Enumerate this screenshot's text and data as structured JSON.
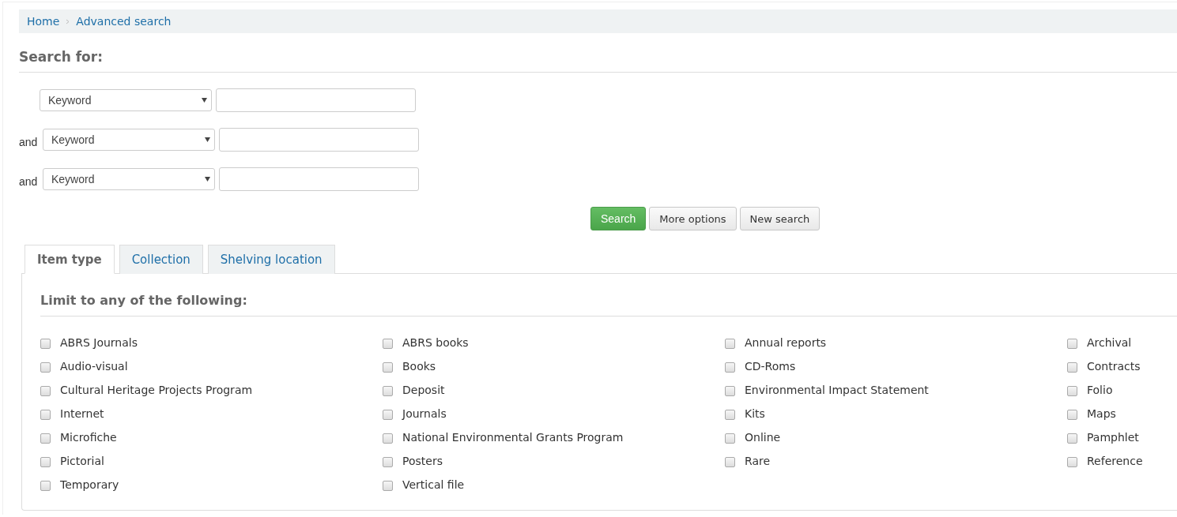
{
  "breadcrumb": [
    {
      "label": "Home"
    },
    {
      "label": "Advanced search"
    }
  ],
  "heading": "Search for:",
  "search_rows": [
    {
      "connector": "",
      "field": "Keyword",
      "value": ""
    },
    {
      "connector": "and",
      "field": "Keyword",
      "value": ""
    },
    {
      "connector": "and",
      "field": "Keyword",
      "value": ""
    }
  ],
  "buttons": [
    {
      "label": "Search",
      "kind": "primary"
    },
    {
      "label": "More options",
      "kind": "default"
    },
    {
      "label": "New search",
      "kind": "default"
    }
  ],
  "tabs": [
    {
      "label": "Item type",
      "selected": true
    },
    {
      "label": "Collection",
      "selected": false
    },
    {
      "label": "Shelving location",
      "selected": false
    }
  ],
  "limit_heading": "Limit to any of the following:",
  "item_types": [
    {
      "label": "ABRS Journals",
      "checked": false
    },
    {
      "label": "ABRS books",
      "checked": false
    },
    {
      "label": "Annual reports",
      "checked": false
    },
    {
      "label": "Archival",
      "checked": false
    },
    {
      "label": "Audio-visual",
      "checked": false
    },
    {
      "label": "Books",
      "checked": false
    },
    {
      "label": "CD-Roms",
      "checked": false
    },
    {
      "label": "Contracts",
      "checked": false
    },
    {
      "label": "Cultural Heritage Projects Program",
      "checked": false
    },
    {
      "label": "Deposit",
      "checked": false
    },
    {
      "label": "Environmental Impact Statement",
      "checked": false
    },
    {
      "label": "Folio",
      "checked": false
    },
    {
      "label": "Internet",
      "checked": false
    },
    {
      "label": "Journals",
      "checked": false
    },
    {
      "label": "Kits",
      "checked": false
    },
    {
      "label": "Maps",
      "checked": false
    },
    {
      "label": "Microfiche",
      "checked": false
    },
    {
      "label": "National Environmental Grants Program",
      "checked": false
    },
    {
      "label": "Online",
      "checked": false
    },
    {
      "label": "Pamphlet",
      "checked": false
    },
    {
      "label": "Pictorial",
      "checked": false
    },
    {
      "label": "Posters",
      "checked": false
    },
    {
      "label": "Rare",
      "checked": false
    },
    {
      "label": "Reference",
      "checked": false
    },
    {
      "label": "Temporary",
      "checked": false
    },
    {
      "label": "Vertical file",
      "checked": false
    }
  ]
}
